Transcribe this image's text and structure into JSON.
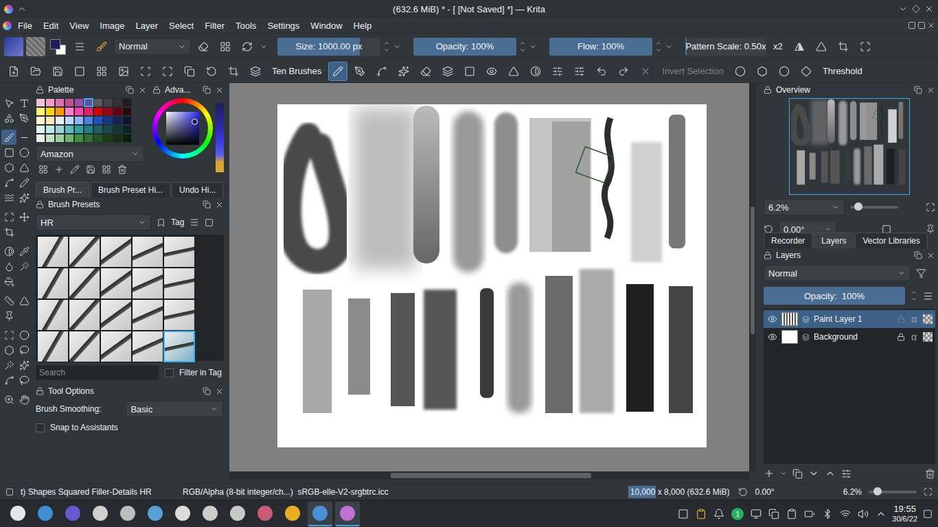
{
  "window": {
    "title": "(632.6 MiB) * - [ [Not Saved] *] — Krita"
  },
  "menu": [
    "File",
    "Edit",
    "View",
    "Image",
    "Layer",
    "Select",
    "Filter",
    "Tools",
    "Settings",
    "Window",
    "Help"
  ],
  "brush_toolbar": {
    "blend_mode": "Normal",
    "foreground_color": "#1e1c5a",
    "background_color": "#ffffff",
    "sliders": [
      {
        "label": "Size: 1000.00 px",
        "level": 0.8
      },
      {
        "label": "Opacity: 100%",
        "level": 1
      },
      {
        "label": "Flow: 100%",
        "level": 1
      },
      {
        "label": "Pattern Scale: 0.50x",
        "level": 0.02
      }
    ],
    "multiplier": "x2"
  },
  "tool_toolbar": [
    {
      "kind": "icon",
      "selected": false,
      "disabled": false
    },
    {
      "kind": "icon",
      "selected": false,
      "disabled": false
    },
    {
      "kind": "icon",
      "selected": false,
      "disabled": false
    },
    {
      "kind": "icon",
      "selected": false,
      "disabled": false
    },
    {
      "kind": "icon",
      "selected": false,
      "disabled": false
    },
    {
      "kind": "icon",
      "selected": false,
      "disabled": false
    },
    {
      "kind": "icon",
      "selected": false,
      "disabled": false
    },
    {
      "kind": "icon",
      "selected": false,
      "disabled": false
    },
    {
      "kind": "icon",
      "selected": false,
      "disabled": false
    },
    {
      "kind": "icon",
      "selected": false,
      "disabled": false
    },
    {
      "kind": "icon",
      "selected": false,
      "disabled": false
    },
    {
      "kind": "icon",
      "selected": false,
      "disabled": false
    },
    {
      "kind": "label",
      "label": "Ten Brushes",
      "selected": false,
      "disabled": false
    },
    {
      "kind": "icon",
      "selected": true,
      "disabled": false
    },
    {
      "kind": "icon",
      "selected": false,
      "disabled": false
    },
    {
      "kind": "icon",
      "selected": false,
      "disabled": false
    },
    {
      "kind": "icon",
      "selected": false,
      "disabled": false
    },
    {
      "kind": "icon",
      "selected": false,
      "disabled": false
    },
    {
      "kind": "icon",
      "selected": false,
      "disabled": false
    },
    {
      "kind": "icon",
      "selected": false,
      "disabled": false
    },
    {
      "kind": "icon",
      "selected": false,
      "disabled": false
    },
    {
      "kind": "icon",
      "selected": false,
      "disabled": false
    },
    {
      "kind": "icon",
      "selected": false,
      "disabled": false
    },
    {
      "kind": "icon",
      "selected": false,
      "disabled": false
    },
    {
      "kind": "icon",
      "selected": false,
      "disabled": false
    },
    {
      "kind": "icon",
      "selected": false,
      "disabled": false
    },
    {
      "kind": "icon",
      "selected": false,
      "disabled": false
    },
    {
      "kind": "icon",
      "selected": false,
      "disabled": true
    },
    {
      "kind": "label",
      "label": "Invert Selection",
      "selected": false,
      "disabled": true
    },
    {
      "kind": "icon",
      "selected": false,
      "disabled": false
    },
    {
      "kind": "icon",
      "selected": false,
      "disabled": false
    },
    {
      "kind": "icon",
      "selected": false,
      "disabled": false
    },
    {
      "kind": "icon",
      "selected": false,
      "disabled": false
    },
    {
      "kind": "label",
      "label": "Threshold",
      "selected": false,
      "disabled": false
    }
  ],
  "toolbox": [
    [
      {
        "selected": false
      },
      {
        "selected": false
      },
      {
        "selected": false
      },
      {
        "selected": false
      }
    ],
    [
      {
        "selected": true
      },
      {
        "selected": false
      },
      {
        "selected": false
      },
      {
        "selected": false
      },
      {
        "selected": false
      },
      {
        "selected": false
      },
      {
        "selected": false
      },
      {
        "selected": false
      },
      {
        "selected": false
      },
      {
        "selected": false
      }
    ],
    [
      {
        "selected": false
      },
      {
        "selected": false
      },
      {
        "selected": false
      }
    ],
    [
      {
        "selected": false
      },
      {
        "selected": false
      },
      {
        "selected": false
      },
      {
        "selected": false
      },
      {
        "selected": false
      }
    ],
    [
      {
        "selected": false
      },
      {
        "selected": false
      },
      {
        "selected": false
      }
    ],
    [
      {
        "selected": false
      },
      {
        "selected": false
      },
      {
        "selected": false
      },
      {
        "selected": false
      },
      {
        "selected": false
      },
      {
        "selected": false
      },
      {
        "selected": false
      },
      {
        "selected": false
      }
    ],
    [
      {
        "selected": false
      },
      {
        "selected": false
      }
    ]
  ],
  "palette": {
    "title": "Palette",
    "name": "Amazon",
    "swatches": [
      {
        "color": "#f4c2d7",
        "selected": false
      },
      {
        "color": "#f09ac4",
        "selected": false
      },
      {
        "color": "#e070b0",
        "selected": false
      },
      {
        "color": "#c0508f",
        "selected": false
      },
      {
        "color": "#9a4fa8",
        "selected": false
      },
      {
        "color": "#6a4ca0",
        "selected": true
      },
      {
        "color": "#5a5a5a",
        "selected": false
      },
      {
        "color": "#444444",
        "selected": false
      },
      {
        "color": "#333333",
        "selected": false
      },
      {
        "color": "#1e1e1e",
        "selected": false
      },
      {
        "color": "#fff176",
        "selected": false
      },
      {
        "color": "#ffd600",
        "selected": false
      },
      {
        "color": "#ff9800",
        "selected": false
      },
      {
        "color": "#ff80c8",
        "selected": false
      },
      {
        "color": "#ff40a8",
        "selected": false
      },
      {
        "color": "#e91e63",
        "selected": false
      },
      {
        "color": "#d50000",
        "selected": false
      },
      {
        "color": "#a00010",
        "selected": false
      },
      {
        "color": "#6a0018",
        "selected": false
      },
      {
        "color": "#2a0a10",
        "selected": false
      },
      {
        "color": "#fff8d8",
        "selected": false
      },
      {
        "color": "#ffe8b8",
        "selected": false
      },
      {
        "color": "#e3f0ff",
        "selected": false
      },
      {
        "color": "#c0d8ff",
        "selected": false
      },
      {
        "color": "#90b8f8",
        "selected": false
      },
      {
        "color": "#4a80e0",
        "selected": false
      },
      {
        "color": "#2050c0",
        "selected": false
      },
      {
        "color": "#16358a",
        "selected": false
      },
      {
        "color": "#122458",
        "selected": false
      },
      {
        "color": "#0e1630",
        "selected": false
      },
      {
        "color": "#e0f4f4",
        "selected": false
      },
      {
        "color": "#c0e8e8",
        "selected": false
      },
      {
        "color": "#98d6d6",
        "selected": false
      },
      {
        "color": "#5cbcbc",
        "selected": false
      },
      {
        "color": "#2ea0a0",
        "selected": false
      },
      {
        "color": "#1f8080",
        "selected": false
      },
      {
        "color": "#1c6262",
        "selected": false
      },
      {
        "color": "#174a4a",
        "selected": false
      },
      {
        "color": "#103838",
        "selected": false
      },
      {
        "color": "#082626",
        "selected": false
      },
      {
        "color": "#e8f2e8",
        "selected": false
      },
      {
        "color": "#c6e2c6",
        "selected": false
      },
      {
        "color": "#9ed09e",
        "selected": false
      },
      {
        "color": "#6eb26e",
        "selected": false
      },
      {
        "color": "#3f913f",
        "selected": false
      },
      {
        "color": "#2f712f",
        "selected": false
      },
      {
        "color": "#225522",
        "selected": false
      },
      {
        "color": "#1a401a",
        "selected": false
      },
      {
        "color": "#123012",
        "selected": false
      },
      {
        "color": "#0a200a",
        "selected": false
      }
    ]
  },
  "color_selector": {
    "title": "Adva..."
  },
  "left_tabs": [
    {
      "label": "Brush Pr...",
      "selected": true
    },
    {
      "label": "Brush Preset Hi...",
      "selected": false
    },
    {
      "label": "Undo Hi...",
      "selected": false
    }
  ],
  "brush_presets": {
    "title": "Brush Presets",
    "tag": "HR",
    "tag_button": "Tag",
    "presets": [
      {
        "selected": false
      },
      {
        "selected": false
      },
      {
        "selected": false
      },
      {
        "selected": false
      },
      {
        "selected": false
      },
      {
        "selected": false
      },
      {
        "selected": false
      },
      {
        "selected": false
      },
      {
        "selected": false
      },
      {
        "selected": false
      },
      {
        "selected": false
      },
      {
        "selected": false
      },
      {
        "selected": false
      },
      {
        "selected": false
      },
      {
        "selected": false
      },
      {
        "selected": false
      },
      {
        "selected": false
      },
      {
        "selected": false
      },
      {
        "selected": false
      },
      {
        "selected": true
      }
    ],
    "search_placeholder": "Search",
    "filter_in_tag": {
      "label": "Filter in Tag",
      "checked": false
    }
  },
  "tool_options": {
    "title": "Tool Options",
    "smoothing_label": "Brush Smoothing:",
    "smoothing": "Basic",
    "snap": {
      "label": "Snap to Assistants",
      "checked": false
    }
  },
  "overview": {
    "title": "Overview",
    "zoom": "6.2%",
    "zoom_level": 0.08,
    "rotation": "0.00°"
  },
  "right_tabs": [
    {
      "label": "Recorder",
      "selected": false
    },
    {
      "label": "Layers",
      "selected": true
    },
    {
      "label": "Vector Libraries",
      "selected": false
    }
  ],
  "layers": {
    "title": "Layers",
    "blend_mode": "Normal",
    "opacity": {
      "label": "Opacity:  100%",
      "level": 1
    },
    "items": [
      {
        "name": "Paint Layer 1",
        "visible": true,
        "selected": true,
        "locked": false,
        "alpha": "α"
      },
      {
        "name": "Background",
        "visible": true,
        "selected": false,
        "locked": true,
        "alpha": "α"
      }
    ]
  },
  "status_bar": {
    "preset": "t) Shapes Squared Filler-Details HR",
    "color_space": "RGB/Alpha (8-bit integer/ch...)  sRGB-elle-V2-srgbtrc.icc",
    "size": "10,000 x 8,000 (632.6 MiB)",
    "rotation": "0.00°",
    "zoom": "6.2%",
    "zoom_level": 0.1
  },
  "taskbar": {
    "apps": [
      {
        "color": "#e6e6e6",
        "active": false
      },
      {
        "color": "#3d8fd6",
        "active": false
      },
      {
        "color": "#6a58d0",
        "active": false
      },
      {
        "color": "#cfcfcf",
        "active": false
      },
      {
        "color": "#bdbdbd",
        "active": false
      },
      {
        "color": "#5aa0d8",
        "active": false
      },
      {
        "color": "#dcdcdc",
        "active": false
      },
      {
        "color": "#cccccc",
        "active": false
      },
      {
        "color": "#c8c8c8",
        "active": false
      },
      {
        "color": "#c85a7a",
        "active": false
      },
      {
        "color": "#e8b020",
        "active": false
      },
      {
        "color": "#4a90d9",
        "active": true
      },
      {
        "color": "#c070d0",
        "active": true
      }
    ],
    "badge": "1",
    "time": "19:55",
    "date": "30/6/22"
  }
}
